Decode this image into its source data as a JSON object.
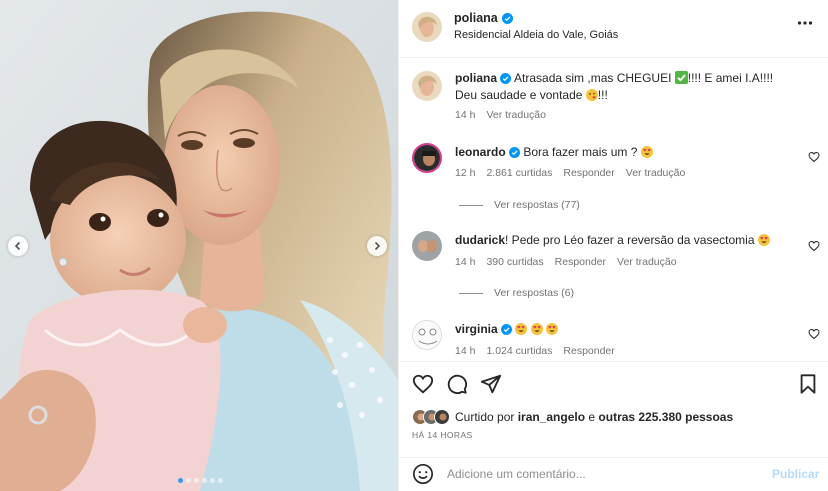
{
  "post": {
    "username": "poliana",
    "location": "Residencial Aldeia do Vale, Goiás",
    "more_icon": "more-horizontal-icon"
  },
  "caption": {
    "username": "poliana",
    "text_line1": "Atrasada sim ,mas CHEGUEI",
    "text_after_check": "!!!! E amei I.A!!!!",
    "text_line2": "Deu saudade e vontade",
    "text_line2_end": "!!!",
    "time": "14 h",
    "translate": "Ver tradução"
  },
  "comments": [
    {
      "username": "leonardo",
      "verified": true,
      "text": "Bora fazer mais um ?",
      "time": "12 h",
      "likes": "2.861 curtidas",
      "reply": "Responder",
      "translate": "Ver tradução",
      "replies": "Ver respostas (77)"
    },
    {
      "username": "dudarick",
      "verified": false,
      "text": "! Pede pro Léo fazer a reversão da vasectomia",
      "time": "14 h",
      "likes": "390 curtidas",
      "reply": "Responder",
      "translate": "Ver tradução",
      "replies": "Ver respostas (6)"
    },
    {
      "username": "virginia",
      "verified": true,
      "text": "",
      "time": "14 h",
      "likes": "1.024 curtidas",
      "reply": "Responder"
    }
  ],
  "liked": {
    "prefix": "Curtido por ",
    "user": "iran_angelo",
    "middle": " e ",
    "others": "outras 225.380 pessoas"
  },
  "time_ago": "HÁ 14 HORAS",
  "add_comment": {
    "placeholder": "Adicione um comentário...",
    "publish": "Publicar"
  },
  "colors": {
    "verified": "#0095f6",
    "publish_disabled": "#b3dbff",
    "muted_text": "#737373"
  },
  "carousel": {
    "slides": 6,
    "active": 0
  }
}
